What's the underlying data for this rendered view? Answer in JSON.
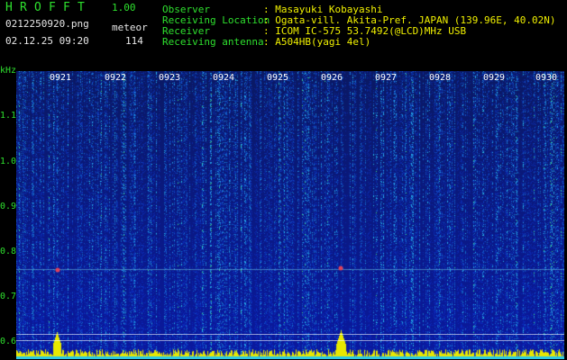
{
  "header": {
    "app_letters": [
      "H",
      "R",
      "O",
      "F",
      "F",
      "T"
    ],
    "version": "1.00",
    "filename": "0212250920.png",
    "mode_label": "meteor",
    "datetime": "02.12.25 09:20",
    "count": "114"
  },
  "info": {
    "labels": [
      "Observer",
      "Receiving Location",
      "Receiver",
      "Receiving antenna"
    ],
    "values": [
      ": Masayuki Kobayashi",
      ": Ogata-vill. Akita-Pref. JAPAN (139.96E, 40.02N)",
      ": ICOM IC-575 53.7492(@LCD)MHz USB",
      ": A504HB(yagi 4el)"
    ]
  },
  "axis": {
    "unit": "kHz",
    "y_ticks": [
      "1.1",
      "1.0",
      "0.9",
      "0.8",
      "0.7",
      "0.6"
    ],
    "x_ticks": [
      "0921",
      "0922",
      "0923",
      "0924",
      "0925",
      "0926",
      "0927",
      "0928",
      "0929",
      "0930"
    ]
  },
  "colors": {
    "background": "#000000",
    "label_green": "#2ee02e",
    "value_white": "#e8e8e8",
    "signal_yellow": "#f0f000",
    "spectrum_blue": "#0a1f6a"
  }
}
